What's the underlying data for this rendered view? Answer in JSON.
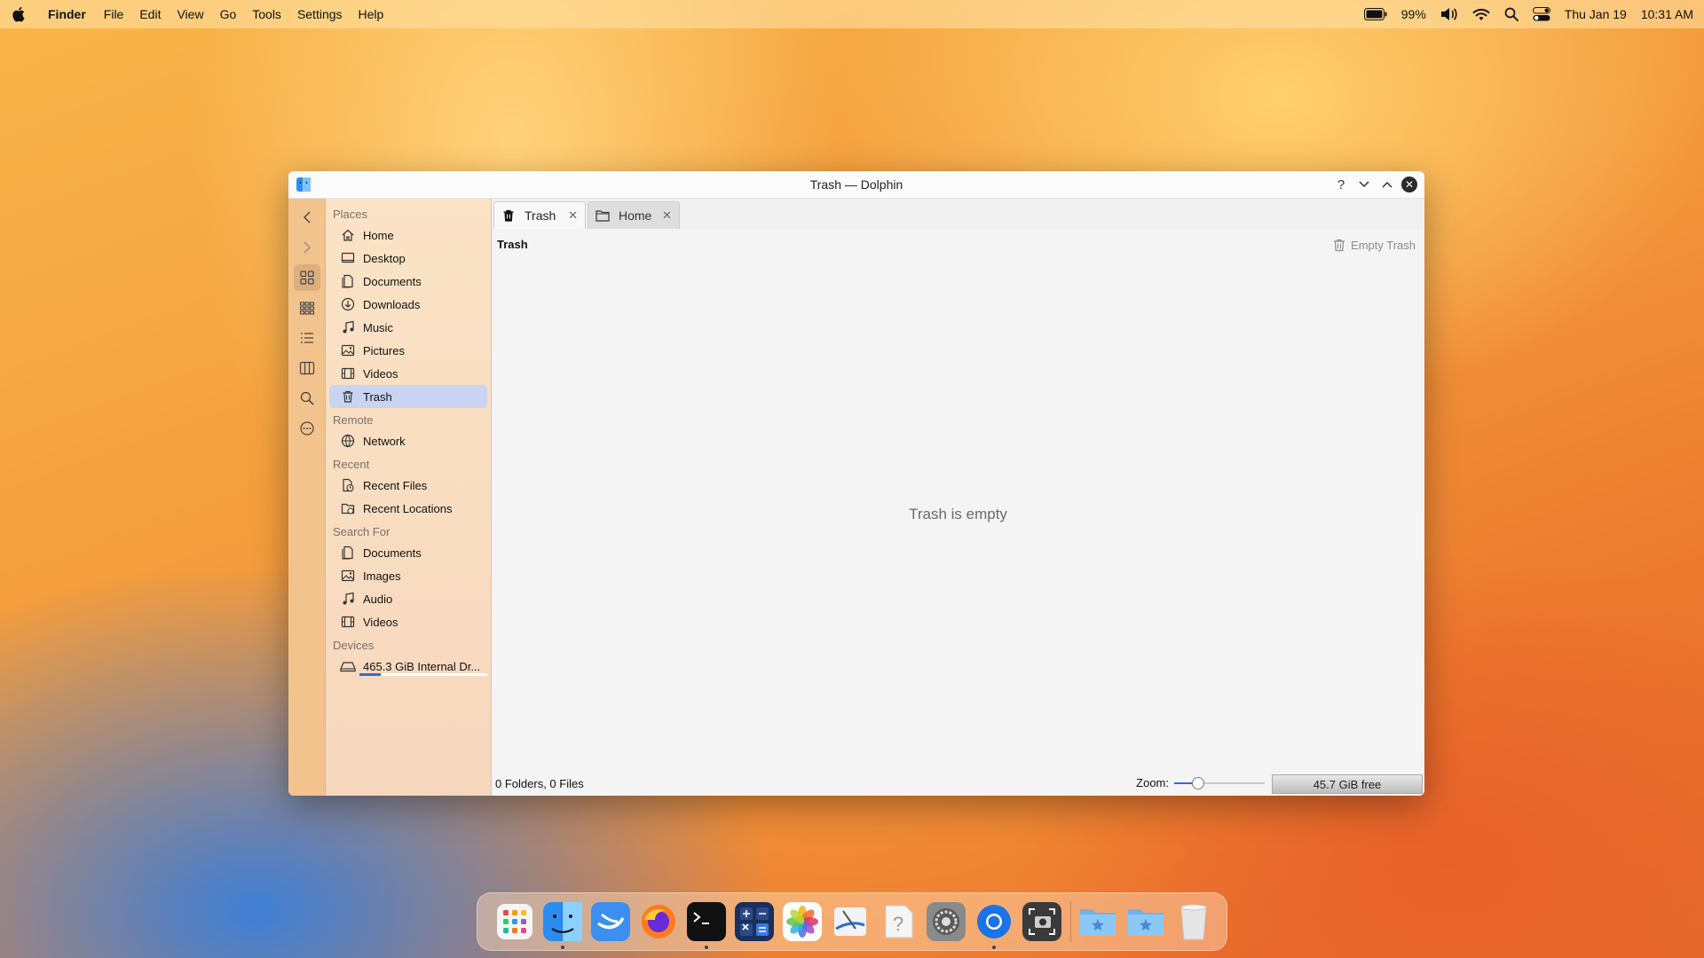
{
  "menubar": {
    "app_name": "Finder",
    "menus": [
      "File",
      "Edit",
      "View",
      "Go",
      "Tools",
      "Settings",
      "Help"
    ],
    "battery": "99%",
    "date": "Thu Jan 19",
    "time": "10:31 AM"
  },
  "window": {
    "title": "Trash — Dolphin",
    "controls": {
      "help": "?",
      "minimize": "⌄",
      "maximize": "⌃",
      "close": "✕"
    }
  },
  "toolbar": {
    "items": [
      "back-icon",
      "forward-icon",
      "icons-view-icon",
      "compact-view-icon",
      "details-view-icon",
      "split-view-icon",
      "search-icon",
      "more-icon"
    ]
  },
  "places": {
    "sections": [
      {
        "title": "Places",
        "items": [
          {
            "label": "Home",
            "icon": "home-icon"
          },
          {
            "label": "Desktop",
            "icon": "desktop-icon"
          },
          {
            "label": "Documents",
            "icon": "documents-icon"
          },
          {
            "label": "Downloads",
            "icon": "downloads-icon"
          },
          {
            "label": "Music",
            "icon": "music-icon"
          },
          {
            "label": "Pictures",
            "icon": "pictures-icon"
          },
          {
            "label": "Videos",
            "icon": "videos-icon"
          },
          {
            "label": "Trash",
            "icon": "trash-icon",
            "selected": true
          }
        ]
      },
      {
        "title": "Remote",
        "items": [
          {
            "label": "Network",
            "icon": "network-icon"
          }
        ]
      },
      {
        "title": "Recent",
        "items": [
          {
            "label": "Recent Files",
            "icon": "recent-files-icon"
          },
          {
            "label": "Recent Locations",
            "icon": "recent-locations-icon"
          }
        ]
      },
      {
        "title": "Search For",
        "items": [
          {
            "label": "Documents",
            "icon": "documents-icon"
          },
          {
            "label": "Images",
            "icon": "images-icon"
          },
          {
            "label": "Audio",
            "icon": "audio-icon"
          },
          {
            "label": "Videos",
            "icon": "videos-icon"
          }
        ]
      },
      {
        "title": "Devices",
        "items": [
          {
            "label": "465.3 GiB Internal Dr...",
            "icon": "drive-icon",
            "usage_fraction": 0.17
          }
        ]
      }
    ]
  },
  "tabs": [
    {
      "label": "Trash",
      "icon": "trash-icon",
      "active": true
    },
    {
      "label": "Home",
      "icon": "folder-icon",
      "active": false
    }
  ],
  "content": {
    "location": "Trash",
    "empty_trash_label": "Empty Trash",
    "empty_message": "Trash is empty"
  },
  "statusbar": {
    "summary": "0 Folders, 0 Files",
    "zoom_label": "Zoom:",
    "zoom_fraction": 0.22,
    "free_space": "45.7 GiB free"
  },
  "dock": {
    "apps": [
      "launchpad-icon",
      "finder-icon",
      "app-icon",
      "firefox-icon",
      "terminal-icon",
      "calculator-icon",
      "photos-icon",
      "preview-icon",
      "help-icon",
      "settings-icon",
      "chrome-icon",
      "screenshot-icon",
      "folder-icon",
      "folder-icon",
      "trash-icon"
    ]
  },
  "colors": {
    "accent": "#3b66d8",
    "selection": "#c9d4f2",
    "sidebar": "#f3c38d"
  }
}
